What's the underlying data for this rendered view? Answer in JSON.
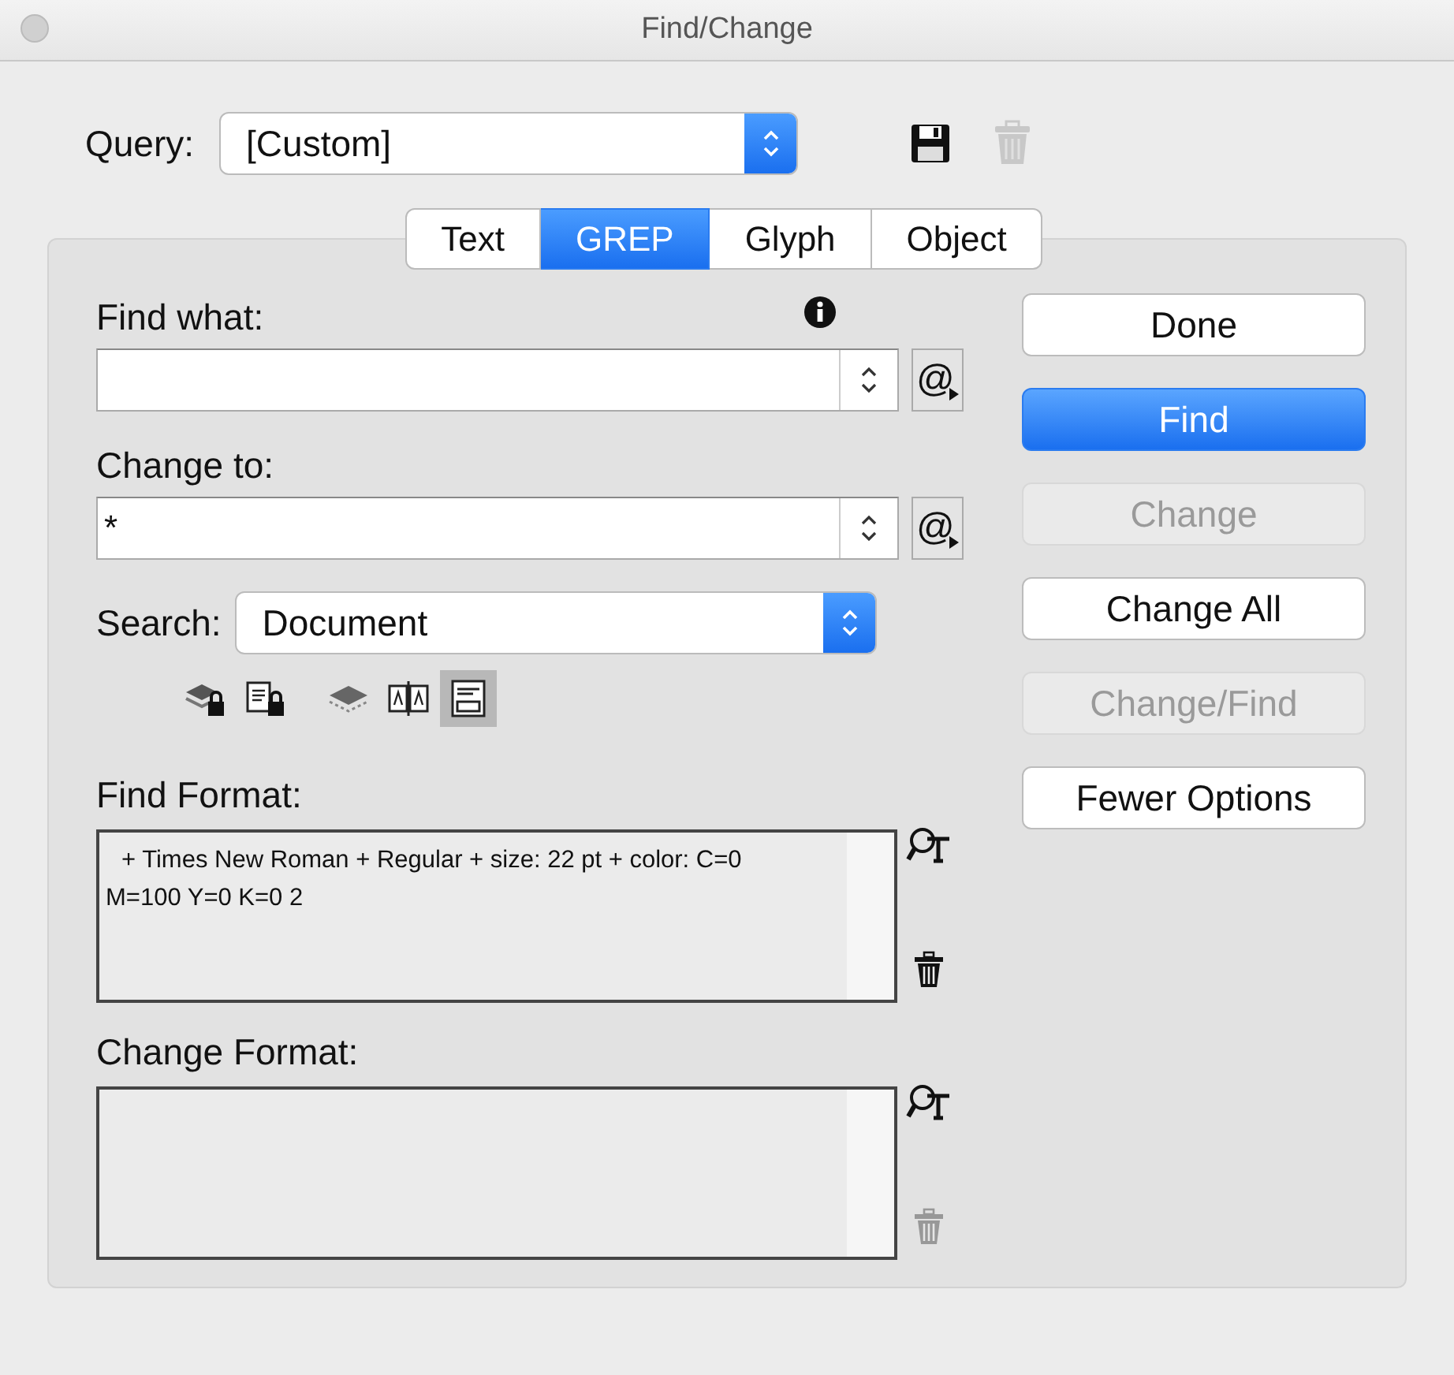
{
  "window": {
    "title": "Find/Change"
  },
  "query": {
    "label": "Query:",
    "value": "[Custom]",
    "save_enabled": true,
    "delete_enabled": false
  },
  "tabs": [
    {
      "label": "Text",
      "selected": false
    },
    {
      "label": "GREP",
      "selected": true
    },
    {
      "label": "Glyph",
      "selected": false
    },
    {
      "label": "Object",
      "selected": false
    }
  ],
  "find_what": {
    "label": "Find what:",
    "menu_glyph": "@"
  },
  "change_to": {
    "label": "Change to:",
    "value": "*",
    "menu_glyph": "@"
  },
  "search": {
    "label": "Search:",
    "value": "Document"
  },
  "search_options": [
    {
      "kind": "locked-layers",
      "selected": false
    },
    {
      "kind": "locked-stories",
      "selected": false
    },
    {
      "kind": "hidden-layers",
      "selected": false
    },
    {
      "kind": "master-pages",
      "selected": false
    },
    {
      "kind": "footnotes",
      "selected": true
    }
  ],
  "find_format": {
    "label": "Find Format:",
    "text": "+ Times New Roman + Regular + size: 22 pt + color: C=0 M=100 Y=0 K=0 2",
    "clear_enabled": true
  },
  "change_format": {
    "label": "Change Format:",
    "clear_enabled": false
  },
  "buttons": [
    {
      "label": "Done",
      "default": false,
      "disabled": false
    },
    {
      "label": "Find",
      "default": true,
      "disabled": false
    },
    {
      "label": "Change",
      "default": false,
      "disabled": true
    },
    {
      "label": "Change All",
      "default": false,
      "disabled": false
    },
    {
      "label": "Change/Find",
      "default": false,
      "disabled": true
    },
    {
      "label": "Fewer Options",
      "default": false,
      "disabled": false
    }
  ]
}
